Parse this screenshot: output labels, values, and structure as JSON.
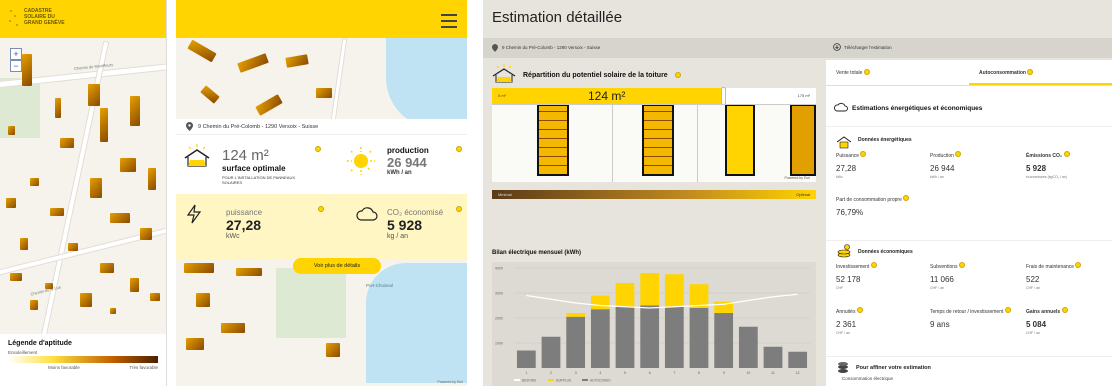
{
  "panel1": {
    "logo": [
      "CADASTRE",
      "SOLAIRE DU",
      "GRAND GENÈVE"
    ],
    "map_labels": [
      "Chemin de Montfleury",
      "Chemin de la Lue"
    ],
    "zoom_in": "+",
    "zoom_out": "−",
    "legend": {
      "title": "Légende d'aptitude",
      "subtitle": "Ensoleillement",
      "low": "Moins favorable",
      "high": "Très favorable"
    }
  },
  "panel2": {
    "address": "9 Chemin du Pré-Colomb - 1290 Versoix - Suisse",
    "surface": {
      "value": "124 m²",
      "label": "surface optimale",
      "note": "POUR L'INSTALLATION DE PANNEAUX SOLAIRES"
    },
    "production": {
      "label": "production",
      "value": "26 944",
      "unit": "kWh / an"
    },
    "puissance": {
      "label": "puissance",
      "value": "27,28",
      "unit": "kWc"
    },
    "co2": {
      "label": "CO₂ économisé",
      "value": "5 928",
      "unit": "kg / an"
    },
    "details_button": "Voir plus de détails",
    "map_label": "Port-Choiseul",
    "credit": "Powered by Esri"
  },
  "panel3": {
    "title": "Estimation détaillée",
    "address": "9 Chemin du Pré-Colomb - 1290 Versoix - Suisse",
    "download": "Télécharger l'estimation",
    "repartition": {
      "title": "Répartition du potentiel solaire de la toiture",
      "min": "0 m²",
      "value": "124 m²",
      "max": "175 m²",
      "bar_low": "Minimal",
      "bar_high": "Optimal",
      "credit": "Powered by Esri"
    },
    "chart_title": "Bilan électrique mensuel (kWh)",
    "legend": [
      "BESOINS",
      "SURPLUS",
      "AUTOCONSO"
    ],
    "tabs": {
      "vente": "Vente totale",
      "auto": "Autoconsommation"
    },
    "estimations_title": "Estimations énergétiques et économiques",
    "energie": {
      "title": "Données énergétiques",
      "puissance": {
        "label": "Puissance",
        "value": "27,28",
        "unit": "kWc"
      },
      "production": {
        "label": "Production",
        "value": "26 944",
        "unit": "kWh / an"
      },
      "emissions": {
        "label": "Émissions CO₂",
        "value": "5 928",
        "unit": "économisées (kgCO₂ / an)"
      },
      "part": {
        "label": "Part de consommation propre",
        "value": "76,79%"
      }
    },
    "economie": {
      "title": "Données économiques",
      "investissement": {
        "label": "Investissement",
        "value": "52 178",
        "unit": "CHF"
      },
      "subventions": {
        "label": "Subventions",
        "value": "11 066",
        "unit": "CHF / an"
      },
      "maintenance": {
        "label": "Frais de maintenance",
        "value": "522",
        "unit": "CHF / an"
      },
      "annuites": {
        "label": "Annuités",
        "value": "2 361",
        "unit": "CHF / an"
      },
      "retour": {
        "label": "Temps de retour / investissement",
        "value": "9 ans"
      },
      "gains": {
        "label": "Gains annuels",
        "value": "5 084",
        "unit": "CHF / an"
      }
    },
    "affiner": {
      "title": "Pour affiner votre estimation",
      "sub": "Consommation électrique"
    }
  },
  "chart_data": {
    "type": "bar",
    "title": "Bilan électrique mensuel (kWh)",
    "categories": [
      "1",
      "2",
      "3",
      "4",
      "5",
      "6",
      "7",
      "8",
      "9",
      "10",
      "11",
      "12"
    ],
    "series": [
      {
        "name": "AUTOCONSO",
        "values": [
          700,
          1250,
          2050,
          2350,
          2450,
          2500,
          2450,
          2400,
          2200,
          1650,
          850,
          650
        ]
      },
      {
        "name": "SURPLUS",
        "values": [
          0,
          0,
          150,
          550,
          950,
          1300,
          1300,
          950,
          450,
          0,
          0,
          0
        ]
      }
    ],
    "besoins_line": [
      2900,
      2750,
      2600,
      2500,
      2450,
      2400,
      2450,
      2500,
      2550,
      2700,
      2850,
      2950
    ],
    "y_ticks": [
      "4000",
      "3000",
      "2000",
      "1000"
    ],
    "ylim": [
      0,
      4000
    ],
    "colors": {
      "AUTOCONSO": "#7d7d7d",
      "SURPLUS": "#ffd400",
      "BESOINS": "#ffffff"
    }
  }
}
